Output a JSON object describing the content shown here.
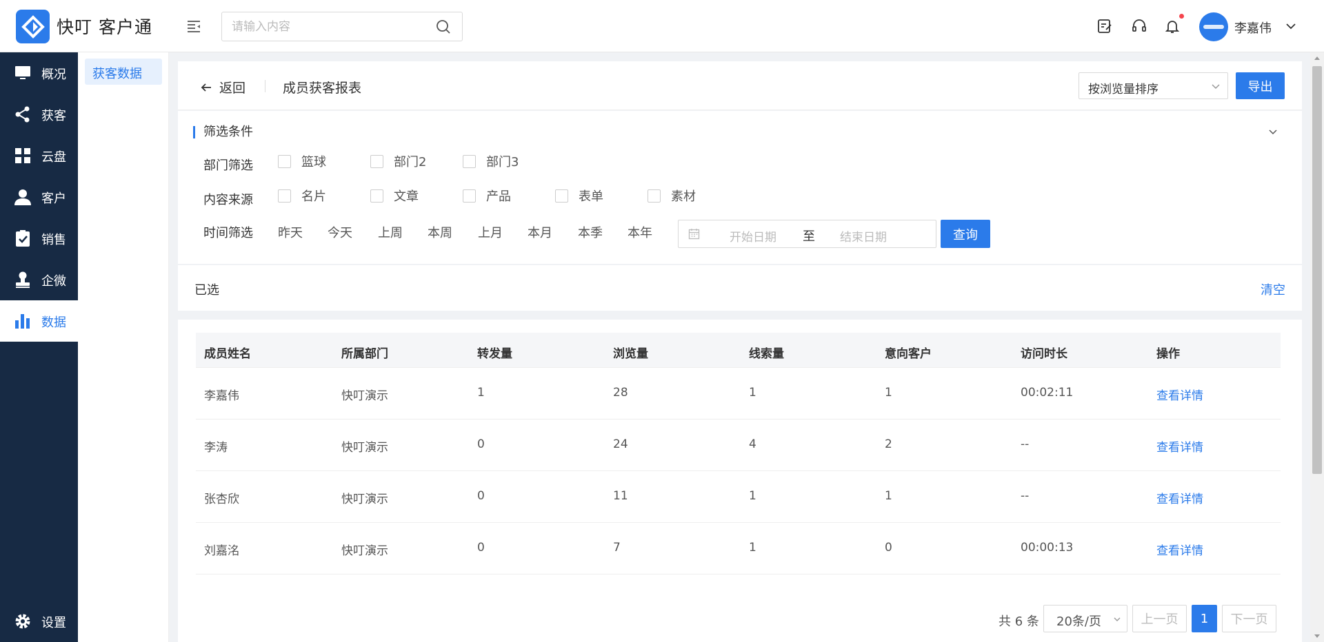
{
  "app": {
    "name": "快叮 客户通"
  },
  "header": {
    "search_placeholder": "请输入内容",
    "user_name": "李嘉伟"
  },
  "nav": {
    "items": [
      {
        "label": "概况",
        "icon": "monitor-icon"
      },
      {
        "label": "获客",
        "icon": "share-icon"
      },
      {
        "label": "云盘",
        "icon": "grid-icon"
      },
      {
        "label": "客户",
        "icon": "user-icon"
      },
      {
        "label": "销售",
        "icon": "clipboard-check-icon"
      },
      {
        "label": "企微",
        "icon": "stamp-icon"
      },
      {
        "label": "数据",
        "icon": "bar-chart-icon",
        "active": true
      }
    ],
    "settings_label": "设置"
  },
  "subnav": {
    "items": [
      {
        "label": "获客数据",
        "active": true
      }
    ]
  },
  "topbar": {
    "back_label": "返回",
    "title": "成员获客报表",
    "sort_value": "按浏览量排序",
    "export_label": "导出"
  },
  "filters": {
    "section_title": "筛选条件",
    "dept_label": "部门筛选",
    "depts": [
      "篮球",
      "部门2",
      "部门3"
    ],
    "source_label": "内容来源",
    "sources": [
      "名片",
      "文章",
      "产品",
      "表单",
      "素材"
    ],
    "time_label": "时间筛选",
    "time_options": [
      "昨天",
      "今天",
      "上周",
      "本周",
      "上月",
      "本月",
      "本季",
      "本年"
    ],
    "start_placeholder": "开始日期",
    "to_label": "至",
    "end_placeholder": "结束日期",
    "query_label": "查询"
  },
  "selected": {
    "label": "已选",
    "clear_label": "清空"
  },
  "table": {
    "columns": [
      "成员姓名",
      "所属部门",
      "转发量",
      "浏览量",
      "线索量",
      "意向客户",
      "访问时长",
      "操作"
    ],
    "rows": [
      [
        "李嘉伟",
        "快叮演示",
        "1",
        "28",
        "1",
        "1",
        "00:02:11",
        "查看详情"
      ],
      [
        "李涛",
        "快叮演示",
        "0",
        "24",
        "4",
        "2",
        "--",
        "查看详情"
      ],
      [
        "张杏欣",
        "快叮演示",
        "0",
        "11",
        "1",
        "1",
        "--",
        "查看详情"
      ],
      [
        "刘嘉洺",
        "快叮演示",
        "0",
        "7",
        "1",
        "0",
        "00:00:13",
        "查看详情"
      ]
    ]
  },
  "pagination": {
    "total": "共 6 条",
    "page_size": "20条/页",
    "prev_label": "上一页",
    "current_page": "1",
    "next_label": "下一页"
  },
  "colors": {
    "primary": "#2b7bea",
    "nav_bg": "#172a44"
  }
}
